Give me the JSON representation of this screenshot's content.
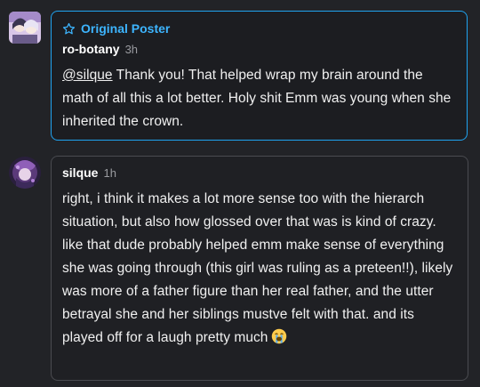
{
  "comments": [
    {
      "badge": "Original Poster",
      "username": "ro-botany",
      "time": "3h",
      "mention": "@silque",
      "text": " Thank you! That helped wrap my brain around the math of all this a lot better. Holy shit  Emm was young when she inherited the crown."
    },
    {
      "username": "silque",
      "time": "1h",
      "text": "right, i think it makes a lot more sense too with the hierarch situation, but also how glossed over that was is kind of crazy. like that dude probably helped emm make sense of everything she was going through (this girl was ruling as a preteen!!), likely was more of a father figure than her real father, and the utter betrayal she and her siblings mustve felt with that. and its played off for a laugh pretty much",
      "emoji": "loudly-crying-face"
    }
  ],
  "colors": {
    "background": "#222327",
    "op_border": "#1fa3f0",
    "badge": "#3db5ff",
    "reply_border": "#4a4b50"
  }
}
